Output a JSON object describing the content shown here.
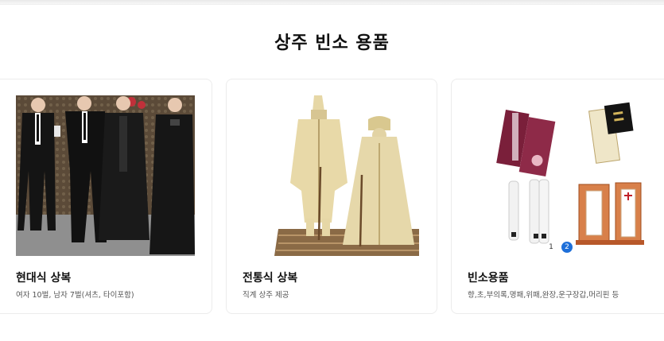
{
  "section": {
    "title": "상주 빈소 용품"
  },
  "cards": [
    {
      "title": "현대식 상복",
      "desc": "여자 10벌, 남자 7벌(셔츠, 타이포함)"
    },
    {
      "title": "전통식 상복",
      "desc": "직계 상주 제공"
    },
    {
      "title": "빈소용품",
      "desc": "향,초,부의록,명패,위패,완장,운구장갑,머리핀 등"
    }
  ],
  "pager": {
    "pages": [
      "1",
      "2"
    ],
    "active": "2"
  },
  "colors": {
    "accent": "#1e6fd9",
    "wine": "#7a1f3a",
    "hemp": "#e8d9a8"
  }
}
